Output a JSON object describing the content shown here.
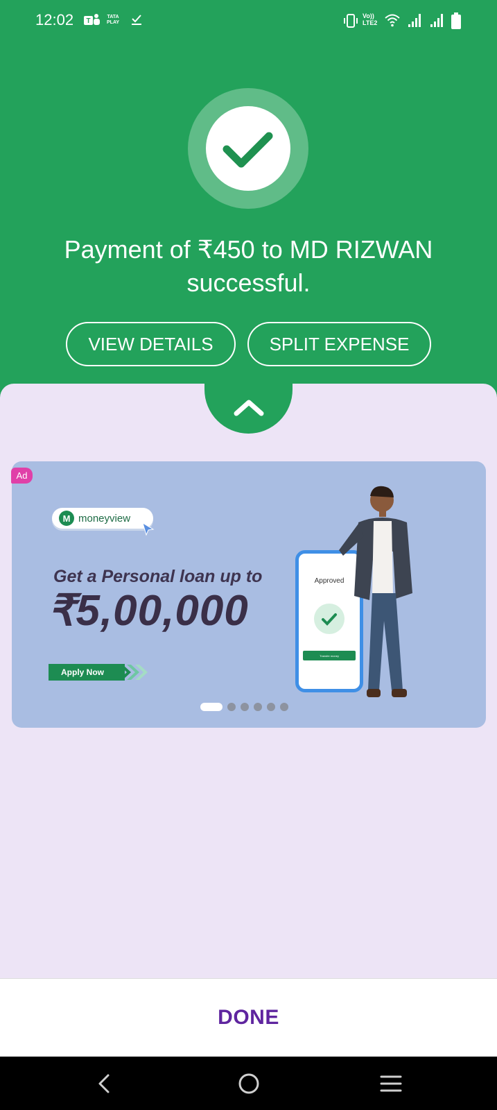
{
  "status_bar": {
    "time": "12:02",
    "tataplay_line1": "TATA",
    "tataplay_line2": "PLAY",
    "volte_line1": "Vo))",
    "volte_line2": "LTE2",
    "icons": [
      "teams-icon",
      "tataplay-icon",
      "check-notif-icon",
      "vibrate-icon",
      "volte-icon",
      "wifi-icon",
      "signal-icon",
      "signal-icon",
      "battery-icon"
    ]
  },
  "success": {
    "icon": "check-icon",
    "message": "Payment of ₹450 to MD RIZWAN successful."
  },
  "actions": {
    "view_details": "VIEW DETAILS",
    "split_expense": "SPLIT EXPENSE"
  },
  "panel": {
    "collapse_icon": "chevron-up-icon"
  },
  "ad": {
    "badge": "Ad",
    "brand_mark": "M",
    "brand": "moneyview",
    "headline": "Get a Personal loan up to",
    "amount": "₹5,00,000",
    "cta": "Apply Now",
    "phone_status": "Approved",
    "phone_button": "Transfer money",
    "carousel_total": 6,
    "carousel_active": 1
  },
  "footer": {
    "done": "DONE"
  },
  "nav": {
    "icons": [
      "back-icon",
      "home-icon",
      "menu-icon"
    ]
  },
  "colors": {
    "success_green": "#23a25b",
    "panel_lavender": "#ede4f6",
    "done_purple": "#5f259f",
    "ad_background": "#a9bde2"
  }
}
